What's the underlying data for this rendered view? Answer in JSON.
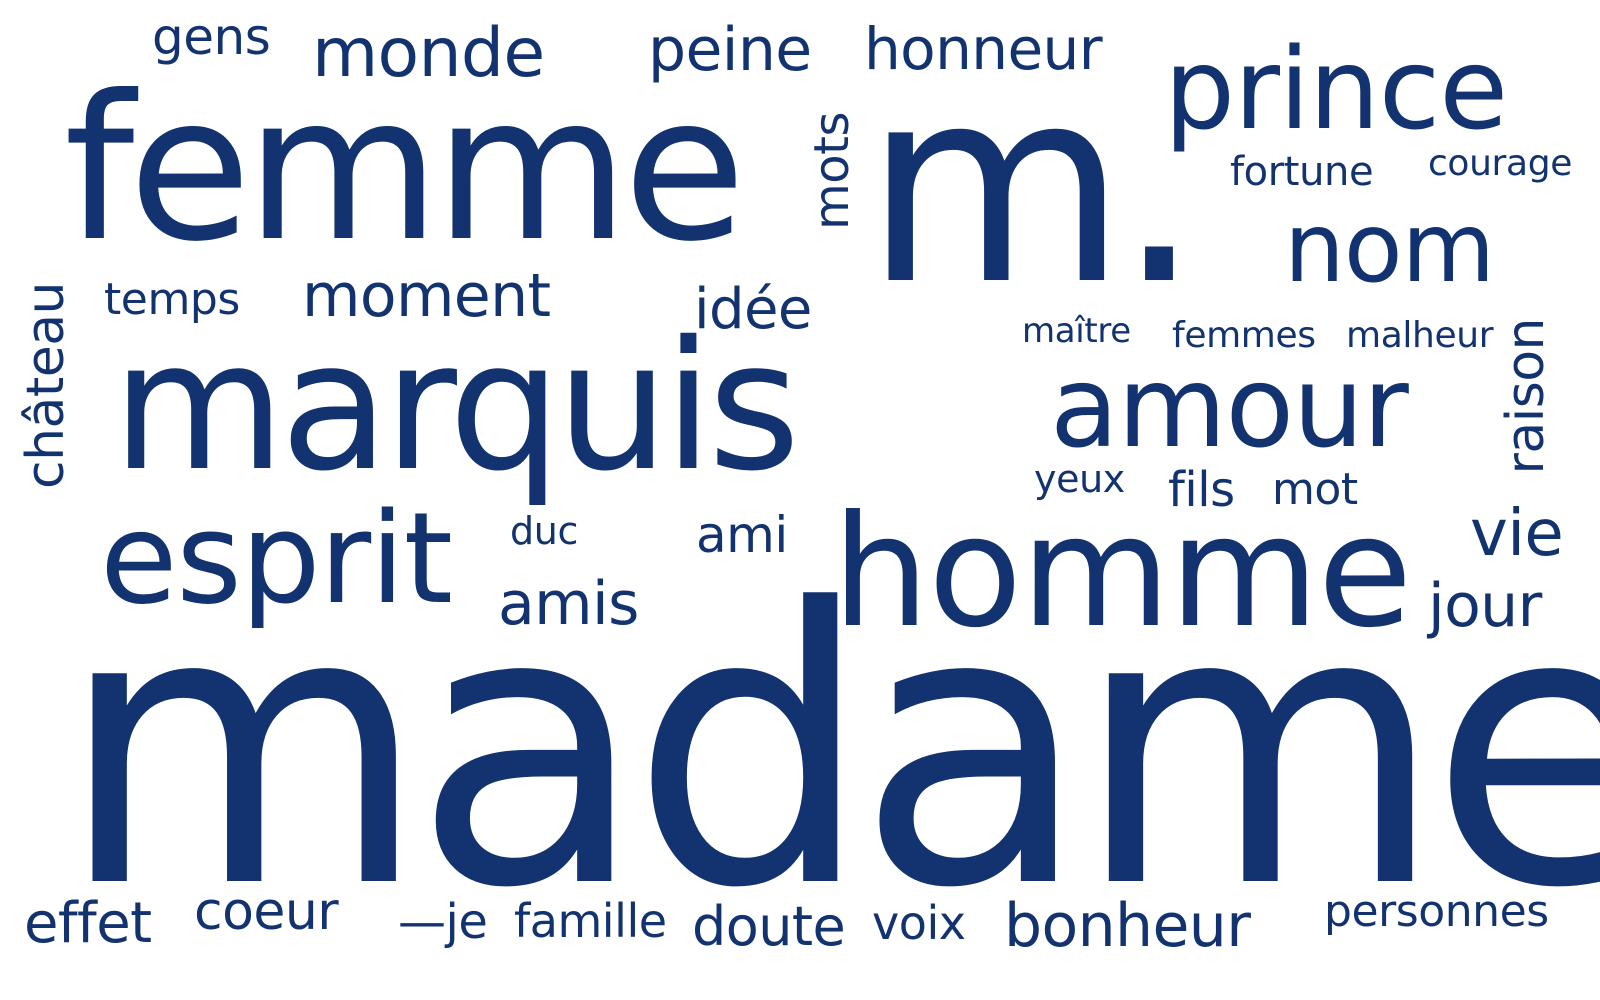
{
  "colors": {
    "background": "#ffffff",
    "word": "#12336f"
  },
  "words": {
    "gens": "gens",
    "monde": "monde",
    "peine": "peine",
    "honneur": "honneur",
    "prince": "prince",
    "femme": "femme",
    "m": "m.",
    "mots": "mots",
    "fortune": "fortune",
    "courage": "courage",
    "nom": "nom",
    "chateau": "château",
    "temps": "temps",
    "moment": "moment",
    "idee": "idée",
    "maitre": "maître",
    "femmes": "femmes",
    "malheur": "malheur",
    "raison": "raison",
    "marquis": "marquis",
    "amour": "amour",
    "yeux": "yeux",
    "fils": "fils",
    "mot": "mot",
    "duc": "duc",
    "ami": "ami",
    "vie": "vie",
    "esprit": "esprit",
    "homme": "homme",
    "amis": "amis",
    "jour": "jour",
    "madame": "madame",
    "effet": "effet",
    "coeur": "coeur",
    "je": "—je",
    "famille": "famille",
    "doute": "doute",
    "voix": "voix",
    "bonheur": "bonheur",
    "personnes": "personnes"
  }
}
